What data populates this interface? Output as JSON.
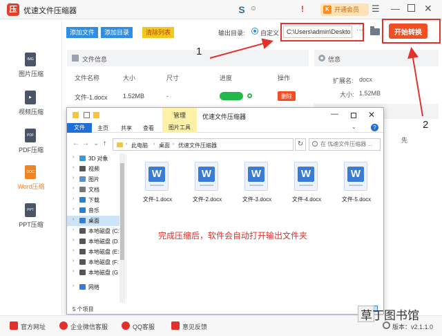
{
  "app": {
    "title": "优速文件压缩器",
    "vip_label": "开通会员",
    "version_label": "版本：",
    "version": "v2.1.1.0"
  },
  "sidebar": {
    "items": [
      {
        "label": "图片压缩",
        "icon": "image-file-icon"
      },
      {
        "label": "视频压缩",
        "icon": "video-file-icon"
      },
      {
        "label": "PDF压缩",
        "icon": "pdf-file-icon"
      },
      {
        "label": "Word压缩",
        "icon": "doc-file-icon",
        "active": true
      },
      {
        "label": "PPT压缩",
        "icon": "ppt-file-icon"
      }
    ]
  },
  "toolbar": {
    "add_file": "添加文件",
    "add_dir": "添加目录",
    "clear_list": "清除列表",
    "output_label": "输出目录:",
    "radio_label": "自定义",
    "output_path": "C:\\Users\\admin\\Deskto",
    "more": "···",
    "start": "开始转换"
  },
  "file_panel": {
    "title": "文件信息",
    "columns": [
      "文件名称",
      "大小",
      "尺寸",
      "进度",
      "操作"
    ],
    "rows": [
      {
        "name": "文件-1.docx",
        "size": "1.52MB",
        "dim": "-",
        "progress": 1.0,
        "action": "删除"
      }
    ]
  },
  "info_panel": {
    "title": "信息",
    "ext_label": "扩展名:",
    "ext_value": "docx",
    "size_label": "大小:",
    "size_value": "1.52MB",
    "partial_text": "先"
  },
  "explorer": {
    "title": "优速文件压缩器",
    "manage_tab": "管理",
    "ribbon": {
      "file": "文件",
      "home": "主页",
      "share": "共享",
      "view": "查看",
      "tools": "图片工具"
    },
    "breadcrumb": [
      "此电脑",
      "桌面",
      "优速文件压缩器"
    ],
    "search_placeholder": "在 优速文件压缩器 ...",
    "nav": [
      {
        "label": "3D 对象",
        "color": "#3a9ad9"
      },
      {
        "label": "视频",
        "color": "#555"
      },
      {
        "label": "图片",
        "color": "#5b8fc7"
      },
      {
        "label": "文档",
        "color": "#777"
      },
      {
        "label": "下载",
        "color": "#2f7fd0"
      },
      {
        "label": "音乐",
        "color": "#2f7fd0"
      },
      {
        "label": "桌面",
        "color": "#3a7bd5",
        "selected": true
      },
      {
        "label": "本地磁盘 (C:",
        "color": "#555"
      },
      {
        "label": "本地磁盘 (D",
        "color": "#555"
      },
      {
        "label": "本地磁盘 (E:",
        "color": "#555"
      },
      {
        "label": "本地磁盘 (F:",
        "color": "#555"
      },
      {
        "label": "本地磁盘 (G",
        "color": "#555"
      },
      {
        "label": "网络",
        "color": "#3a7bd5"
      }
    ],
    "files": [
      "文件-1.docx",
      "文件-2.docx",
      "文件-3.docx",
      "文件-4.docx",
      "文件-5.docx"
    ],
    "status": "5 个项目"
  },
  "notice": "完成压缩后，软件会自动打开输出文件夹",
  "annotations": {
    "one": "1",
    "two": "2"
  },
  "bottombar": {
    "website": "官方网址",
    "wechat": "企业微信客服",
    "qq": "QQ客服",
    "feedback": "意见反馈"
  },
  "watermark": "草丁图书馆",
  "colors": {
    "accent_orange": "#f04f25",
    "blue": "#2f8de3",
    "annotation_red": "#e2302a"
  }
}
